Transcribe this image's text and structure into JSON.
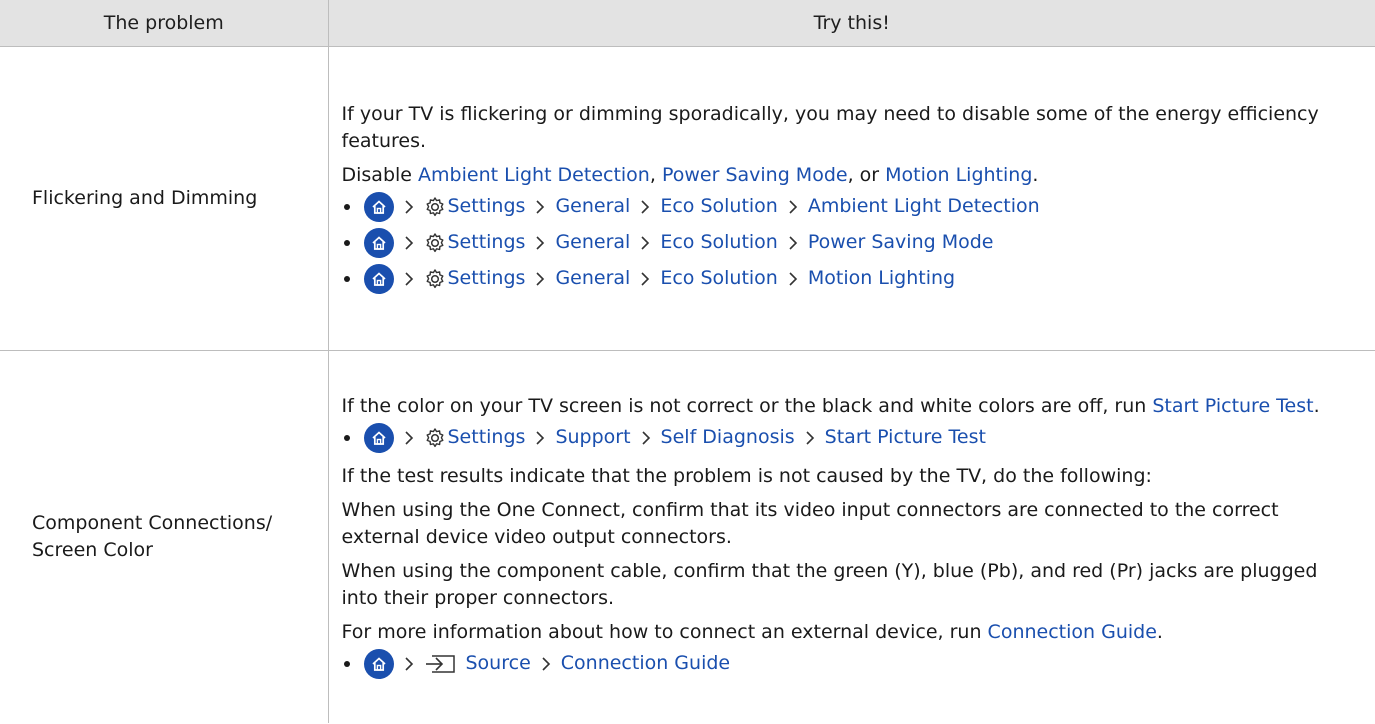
{
  "colors": {
    "link": "#1a4fae",
    "header_bg": "#e3e3e3",
    "home_button": "#1a4fae"
  },
  "header": {
    "col_problem": "The problem",
    "col_try": "Try this!"
  },
  "row1": {
    "problem": "Flickering and Dimming",
    "intro": "If your TV is flickering or dimming sporadically, you may need to disable some of the energy efficiency features.",
    "disable_prefix": "Disable ",
    "opt1": "Ambient Light Detection",
    "comma": ", ",
    "opt2": "Power Saving Mode",
    "or": ", or ",
    "opt3": "Motion Lighting",
    "period": ".",
    "paths": [
      {
        "settings": "Settings",
        "general": "General",
        "eco": "Eco Solution",
        "target": "Ambient Light Detection"
      },
      {
        "settings": "Settings",
        "general": "General",
        "eco": "Eco Solution",
        "target": "Power Saving Mode"
      },
      {
        "settings": "Settings",
        "general": "General",
        "eco": "Eco Solution",
        "target": "Motion Lighting"
      }
    ]
  },
  "row2": {
    "problem_line1": "Component Connections/",
    "problem_line2": "Screen Color",
    "intro": "If the color on your TV screen is not correct or the black and white colors are off, run ",
    "intro_link": "Start Picture Test",
    "intro_end": ".",
    "path1": {
      "settings": "Settings",
      "support": "Support",
      "diag": "Self Diagnosis",
      "target": "Start Picture Test"
    },
    "p_test": "If the test results indicate that the problem is not caused by the TV, do the following:",
    "p_one_connect": "When using the One Connect, confirm that its video input connectors are connected to the correct external device video output connectors.",
    "p_component": "When using the component cable, confirm that the green (Y), blue (Pb), and red (Pr) jacks are plugged into their proper connectors.",
    "p_more": "For more information about how to connect an external device, run ",
    "p_more_link": "Connection Guide",
    "p_more_end": ".",
    "path2": {
      "source": "Source",
      "target": "Connection Guide"
    }
  }
}
